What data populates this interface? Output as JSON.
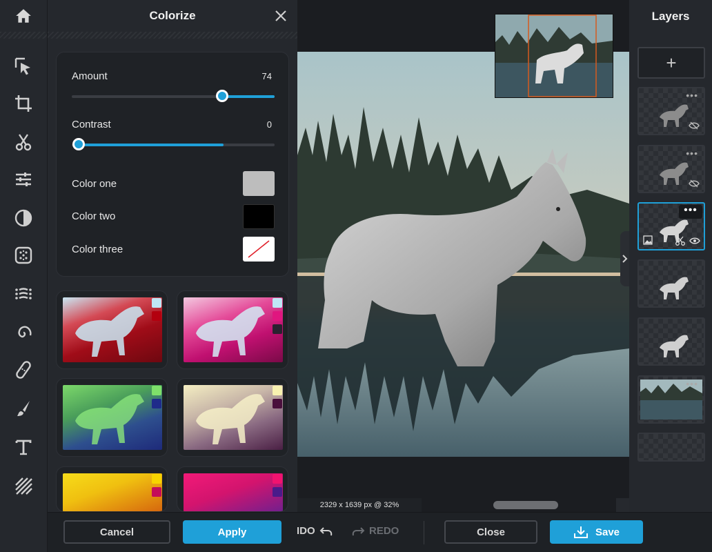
{
  "panel": {
    "title": "Colorize",
    "amount_label": "Amount",
    "amount_value": "74",
    "amount_level": 0.74,
    "contrast_label": "Contrast",
    "contrast_value": "0",
    "contrast_level": 0.0,
    "color_one_label": "Color one",
    "color_one": "#bdbdbd",
    "color_two_label": "Color two",
    "color_two": "#000000",
    "color_three_label": "Color three",
    "color_three": "none",
    "presets": [
      {
        "name": "red",
        "colors": [
          "#bfe6f5",
          "#b3000f"
        ],
        "tint": "#b3101a"
      },
      {
        "name": "magenta",
        "colors": [
          "#bfe6f5",
          "#e0167f"
        ],
        "tint": "#d6207e"
      },
      {
        "name": "green",
        "colors": [
          "#7ee06a",
          "#1f2b8a"
        ],
        "tint": "#3d9a55"
      },
      {
        "name": "cream",
        "colors": [
          "#f8f1b0",
          "#4a0f3c"
        ],
        "tint": "#9e7a8c"
      },
      {
        "name": "yellow",
        "colors": [
          "#f7d400",
          "#c40d5a"
        ],
        "tint": "#e6b20c"
      },
      {
        "name": "pink",
        "colors": [
          "#f0136f",
          "#4a1b8a"
        ],
        "tint": "#d21878"
      }
    ]
  },
  "canvas": {
    "status": "2329 x 1639 px @ 32%"
  },
  "layers": {
    "title": "Layers",
    "add_label": "+",
    "more_label": "•••"
  },
  "actions": {
    "cancel": "Cancel",
    "apply": "Apply",
    "undo": "IDO",
    "redo": "REDO",
    "close": "Close",
    "save": "Save"
  },
  "colors": {
    "accent": "#1fa0d8",
    "panel_bg": "#25282d",
    "app_bg": "#1b1d21"
  }
}
